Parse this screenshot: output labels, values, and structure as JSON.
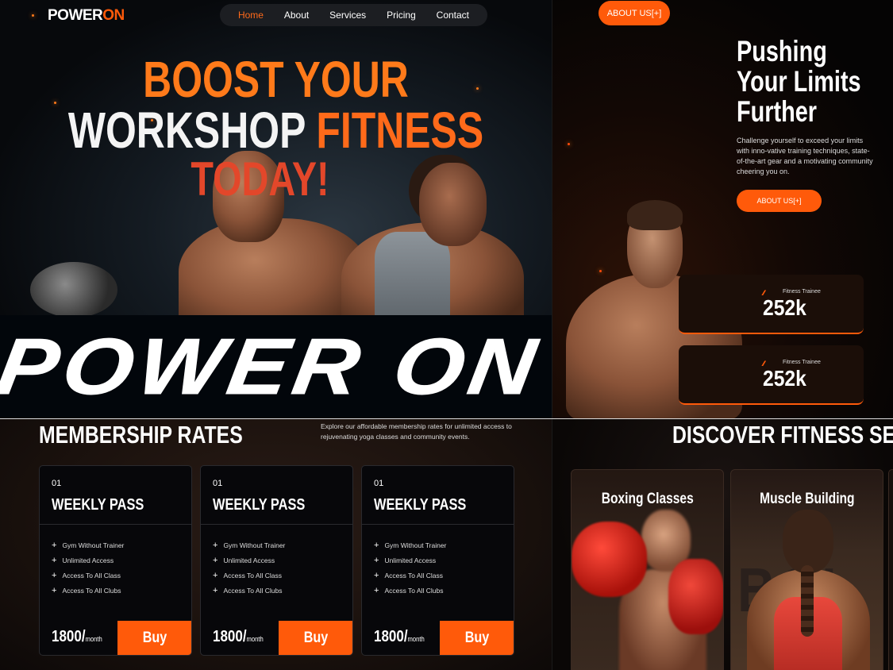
{
  "hero": {
    "logo_a": "POWER",
    "logo_b": "ON",
    "nav": [
      "Home",
      "About",
      "Services",
      "Pricing",
      "Contact"
    ],
    "headline_1": "BOOST YOUR",
    "headline_2a": "WORKSHOP ",
    "headline_2b": "FITNESS",
    "headline_3": "TODAY!",
    "brand": "POWER ON"
  },
  "about": {
    "cta": "ABOUT US[+]",
    "title_1": "Pushing",
    "title_2": "Your Limits",
    "title_3": "Further",
    "text": "Challenge yourself to exceed your limits with inno-vative training techniques, state-of-the-art gear and a motivating community cheering you on.",
    "button": "ABOUT US[+]",
    "stats": [
      {
        "label": "Fitness Trainee",
        "value": "252k"
      },
      {
        "label": "Fitness Trainee",
        "value": "252k"
      }
    ]
  },
  "membership": {
    "title": "MEMBERSHIP RATES",
    "desc": "Explore our affordable membership rates for unlimited access to rejuvenating yoga classes and community events.",
    "cards": [
      {
        "num": "01",
        "name": "WEEKLY PASS",
        "features": [
          "Gym Without Trainer",
          "Unlimited Access",
          "Access To All Class",
          "Access To All Clubs"
        ],
        "price": "1800/",
        "unit": "month",
        "buy": "Buy"
      },
      {
        "num": "01",
        "name": "WEEKLY PASS",
        "features": [
          "Gym Without Trainer",
          "Unlimited Access",
          "Access To All Class",
          "Access To All Clubs"
        ],
        "price": "1800/",
        "unit": "month",
        "buy": "Buy"
      },
      {
        "num": "01",
        "name": "WEEKLY PASS",
        "features": [
          "Gym Without Trainer",
          "Unlimited Access",
          "Access To All Class",
          "Access To All Clubs"
        ],
        "price": "1800/",
        "unit": "month",
        "buy": "Buy"
      }
    ]
  },
  "services": {
    "title": "DISCOVER FITNESS SERV",
    "items": [
      "Boxing Classes",
      "Muscle Building"
    ],
    "bg_letters": "BOI"
  },
  "colors": {
    "accent": "#ff5a0a",
    "headline_orange": "#ff7a1a",
    "background": "#000000"
  }
}
